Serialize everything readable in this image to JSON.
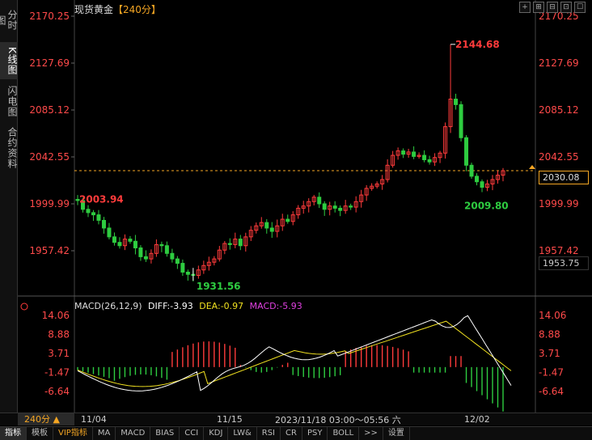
{
  "sidebar": {
    "tabs": [
      "分时图",
      "K线图",
      "闪电图",
      "合约资料"
    ],
    "active": 1
  },
  "header": {
    "title": "现货黄金",
    "period": "【240分】"
  },
  "window_icons": [
    "+",
    "⊞",
    "⊟",
    "⊡",
    "☐"
  ],
  "price_axis": {
    "labels": [
      "2170.25",
      "2127.69",
      "2085.12",
      "2042.55",
      "1999.99",
      "1957.42"
    ],
    "values": [
      2170.25,
      2127.69,
      2085.12,
      2042.55,
      1999.99,
      1957.42
    ]
  },
  "last_price": "2030.08",
  "low_box": "1953.75",
  "annotations": {
    "high": "2144.68",
    "left": "2003.94",
    "low": "1931.56",
    "recent_low": "2009.80"
  },
  "macd": {
    "name": "MACD(26,12,9)",
    "diff_label": "DIFF:-3.93",
    "dea_label": "DEA:-0.97",
    "macd_label": "MACD:-5.93",
    "axis_labels": [
      "14.06",
      "8.88",
      "3.71",
      "-1.47",
      "-6.64"
    ],
    "axis_values": [
      14.06,
      8.88,
      3.71,
      -1.47,
      -6.64
    ]
  },
  "timebar": {
    "period": "240分 ▲",
    "dates": [
      "11/04",
      "11/15",
      "12/02"
    ],
    "cursor_time": "2023/11/18 03:00～05:56 六"
  },
  "tabs": [
    "指标",
    "模板",
    "VIP指标",
    "MA",
    "MACD",
    "BIAS",
    "CCI",
    "KDJ",
    "LW&",
    "RSI",
    "CR",
    "PSY",
    "BOLL",
    ">>",
    "设置"
  ],
  "colors": {
    "up": "#ff3b3b",
    "down": "#2ecc40",
    "diff": "#ffffff",
    "dea": "#f0e020",
    "macd": "#e040e0",
    "last_line": "#f5a623",
    "axis_red": "#ff4a4a"
  },
  "chart_data": {
    "type": "candlestick",
    "instrument": "现货黄金",
    "period": "240分",
    "ylim": [
      1931.56,
      2170.25
    ],
    "high": 2144.68,
    "low": 1931.56,
    "last": 2030.08,
    "close_path": [
      2003,
      1995,
      1992,
      1990,
      1985,
      1978,
      1970,
      1965,
      1962,
      1968,
      1966,
      1960,
      1952,
      1950,
      1955,
      1963,
      1962,
      1955,
      1950,
      1946,
      1938,
      1936,
      1935,
      1940,
      1944,
      1947,
      1950,
      1958,
      1964,
      1963,
      1968,
      1962,
      1970,
      1976,
      1980,
      1983,
      1978,
      1975,
      1980,
      1986,
      1984,
      1990,
      1996,
      1998,
      2002,
      2006,
      2000,
      1995,
      1998,
      1996,
      1994,
      1998,
      1997,
      2002,
      2008,
      2014,
      2016,
      2018,
      2022,
      2035,
      2044,
      2048,
      2045,
      2047,
      2043,
      2044,
      2040,
      2038,
      2042,
      2046,
      2070,
      2095,
      2090,
      2060,
      2035,
      2025,
      2020,
      2015,
      2018,
      2022,
      2026,
      2030
    ]
  }
}
